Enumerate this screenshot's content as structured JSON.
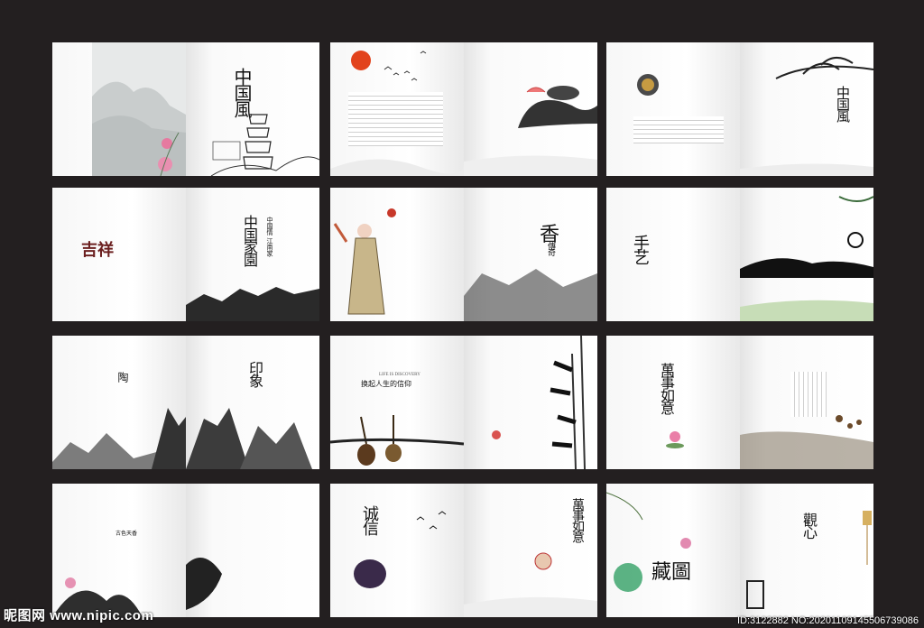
{
  "spreads": [
    {
      "id": "r1c1",
      "title": "中国風"
    },
    {
      "id": "r1c2",
      "title": ""
    },
    {
      "id": "r1c3",
      "title": "中国風"
    },
    {
      "id": "r2c1",
      "title": "吉祥"
    },
    {
      "id": "r2c2",
      "title": "传奇"
    },
    {
      "id": "r2c3",
      "title": "手艺"
    },
    {
      "id": "r3c1",
      "title": "印象"
    },
    {
      "id": "r3c2",
      "title": "换起人生的信仰"
    },
    {
      "id": "r3c3",
      "title": "萬事如意"
    },
    {
      "id": "r4c1",
      "title": "古色天香"
    },
    {
      "id": "r4c2",
      "title": "诚信"
    },
    {
      "id": "r4c3",
      "title": "藏圖"
    }
  ],
  "texts": {
    "r1c1_main": "中国風",
    "r1c3_main": "中国風",
    "r2c1_sub": "中国情 江南家",
    "r2c1_main": "中国家園",
    "r2c2_main": "香",
    "r2c2_sub": "傳奇",
    "r2c3_main": "手艺",
    "r3c1_main": "印象",
    "r3c1_left": "陶",
    "r3c2_line1": "LIFE IS DISCOVERY",
    "r3c2_line2": "换起人生的信仰",
    "r3c3_main": "萬事如意",
    "r4c1_main": "古色天香",
    "r4c2_main": "诚信",
    "r4c2_right": "萬事如意",
    "r4c3_main": "藏圖",
    "r4c3_right": "觀心"
  },
  "watermark": {
    "left": "昵图网 www.nipic.com",
    "right": "ID:3122882 NO:20201109145506739086"
  },
  "colors": {
    "background": "#231f20",
    "seal": "#b7281f",
    "ink": "#111111"
  }
}
